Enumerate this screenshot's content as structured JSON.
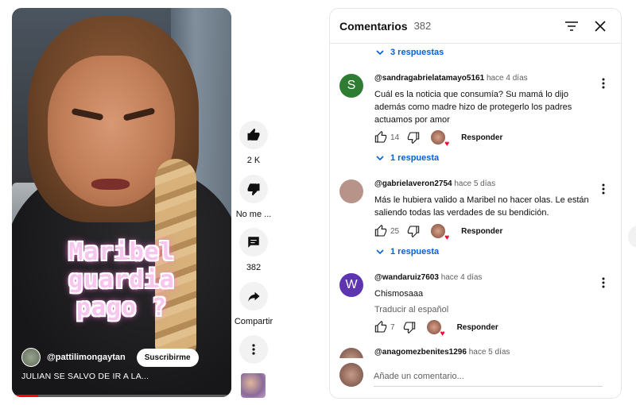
{
  "video": {
    "overlay_lines": [
      "Maribel",
      "guardia",
      "pago ?"
    ],
    "channel_name": "@pattilimongaytan",
    "subscribe_label": "Suscribirme",
    "caption": "JULIAN SE SALVO DE IR A LA...",
    "progress_fraction": 0.12
  },
  "actions": {
    "like_label": "2 K",
    "dislike_label": "No me ...",
    "comments_label": "382",
    "share_label": "Compartir"
  },
  "comments_panel": {
    "title": "Comentarios",
    "count": "382",
    "top_replies_label": "3 respuestas",
    "comments": [
      {
        "avatar_letter": "S",
        "avatar_color": "#2e7d32",
        "author": "@sandragabrielatamayo5161",
        "time": "hace 4 días",
        "text_lines": [
          "Cuál es la noticia que consumía? Su mamá lo dijo",
          "además como madre hizo de protegerlo los padres",
          "actuamos por amor"
        ],
        "likes": "14",
        "reply_label": "Responder",
        "replies_label": "1 respuesta"
      },
      {
        "avatar_letter": "",
        "avatar_color": "#b8938a",
        "author": "@gabrielaveron2754",
        "time": "hace 5 días",
        "text_lines": [
          "Más le hubiera valido a Maribel no hacer olas. Le están",
          "saliendo todas las verdades de su bendición."
        ],
        "likes": "25",
        "reply_label": "Responder",
        "replies_label": "1 respuesta"
      },
      {
        "avatar_letter": "W",
        "avatar_color": "#5e35b1",
        "author": "@wandaruiz7603",
        "time": "hace 4 días",
        "text_lines": [
          "Chismosaaa"
        ],
        "translate_label": "Traducir al español",
        "likes": "7",
        "reply_label": "Responder"
      }
    ],
    "peek": {
      "author": "@anagomezbenites1296",
      "time": "hace 5 días"
    },
    "add_comment_placeholder": "Añade un comentario..."
  }
}
